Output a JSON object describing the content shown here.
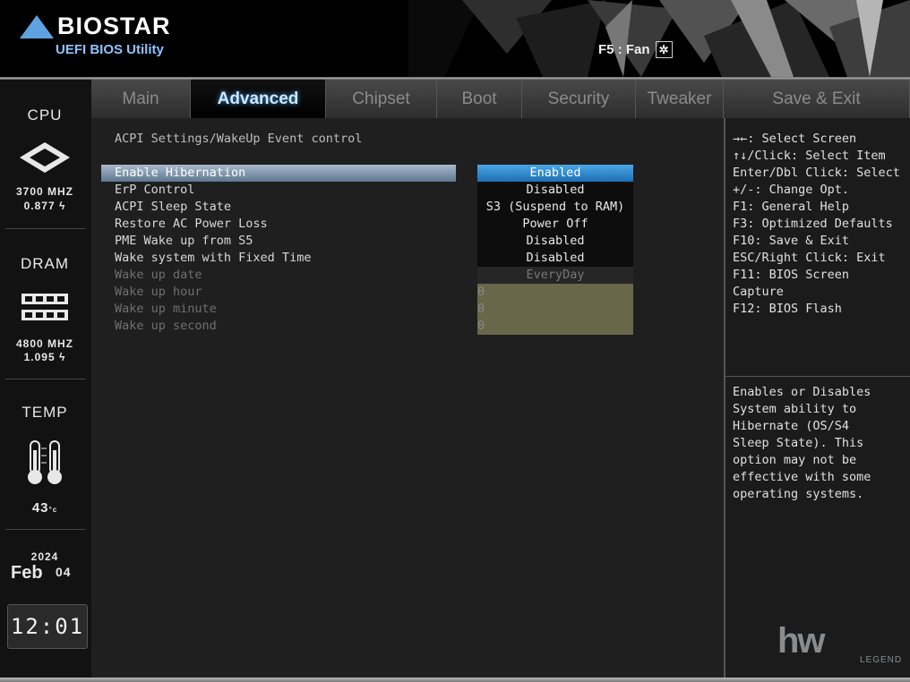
{
  "header": {
    "brand": "BIOSTAR",
    "subtitle": "UEFI BIOS Utility",
    "fan_label": "F5 : Fan"
  },
  "sidebar": {
    "cpu_title": "CPU",
    "cpu_freq": "3700 MHZ",
    "cpu_volt": "0.877",
    "dram_title": "DRAM",
    "dram_freq": "4800 MHZ",
    "dram_volt": "1.095",
    "temp_title": "TEMP",
    "temp_value": "43",
    "temp_unit": "°c",
    "year": "2024",
    "month": "Feb",
    "day": "04",
    "time": "12:01"
  },
  "tabs": [
    {
      "label": "Main"
    },
    {
      "label": "Advanced"
    },
    {
      "label": "Chipset"
    },
    {
      "label": "Boot"
    },
    {
      "label": "Security"
    },
    {
      "label": "Tweaker"
    },
    {
      "label": "Save & Exit"
    }
  ],
  "active_tab": "Advanced",
  "content": {
    "title": "ACPI Settings/WakeUp Event control",
    "items": [
      {
        "label": "Enable Hibernation",
        "value": "Enabled"
      },
      {
        "label": "ErP Control",
        "value": "Disabled"
      },
      {
        "label": "ACPI Sleep State",
        "value": "S3 (Suspend to RAM)"
      },
      {
        "label": "Restore AC Power Loss",
        "value": "Power Off"
      },
      {
        "label": "PME Wake up from S5",
        "value": "Disabled"
      },
      {
        "label": "Wake system with Fixed Time",
        "value": "Disabled"
      },
      {
        "label": "Wake up date",
        "value": "EveryDay"
      },
      {
        "label": "Wake up hour",
        "value": "0"
      },
      {
        "label": "Wake up minute",
        "value": "0"
      },
      {
        "label": "Wake up second",
        "value": "0"
      }
    ]
  },
  "help": {
    "keys": [
      "→←: Select Screen",
      "↑↓/Click: Select Item",
      "Enter/Dbl Click: Select",
      "+/-: Change Opt.",
      "F1: General Help",
      "F3: Optimized Defaults",
      "F10: Save & Exit",
      "ESC/Right Click: Exit",
      "F11: BIOS Screen",
      "Capture",
      "F12: BIOS Flash"
    ],
    "description": [
      "Enables or Disables",
      "System ability to",
      "Hibernate (OS/S4",
      "Sleep State). This",
      "option may not be",
      "effective with some",
      "operating systems."
    ]
  },
  "watermark": {
    "big": "hw",
    "small": "LEGEND"
  },
  "colors": {
    "selected_value_bg": "#1e6fb3",
    "highlight_bar": "#8ea3b9",
    "disabled_field_bg": "#686749"
  }
}
